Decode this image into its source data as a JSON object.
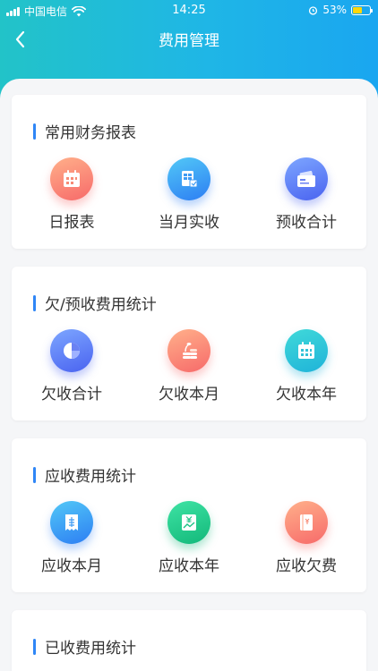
{
  "status": {
    "carrier": "中国电信",
    "time": "14:25",
    "battery": "53%",
    "battery_level": 0.53
  },
  "nav": {
    "title": "费用管理"
  },
  "sections": [
    {
      "title": "常用财务报表",
      "items": [
        {
          "label": "日报表",
          "icon": "calendar-icon",
          "color": "#f76a6a"
        },
        {
          "label": "当月实收",
          "icon": "document-icon",
          "color": "#2d7ef3"
        },
        {
          "label": "预收合计",
          "icon": "wallet-icon",
          "color": "#4a63f0"
        }
      ]
    },
    {
      "title": "欠/预收费用统计",
      "items": [
        {
          "label": "欠收合计",
          "icon": "pie-chart-icon",
          "color": "#4a63f0"
        },
        {
          "label": "欠收本月",
          "icon": "coins-icon",
          "color": "#f76a6a"
        },
        {
          "label": "欠收本年",
          "icon": "calendar-icon",
          "color": "#1fb3d9"
        }
      ]
    },
    {
      "title": "应收费用统计",
      "items": [
        {
          "label": "应收本月",
          "icon": "receipt-icon",
          "color": "#2d7ef3"
        },
        {
          "label": "应收本年",
          "icon": "yen-chart-icon",
          "color": "#13b87a"
        },
        {
          "label": "应收欠费",
          "icon": "bill-icon",
          "color": "#f76a6a"
        }
      ]
    },
    {
      "title": "已收费用统计",
      "items": []
    }
  ]
}
